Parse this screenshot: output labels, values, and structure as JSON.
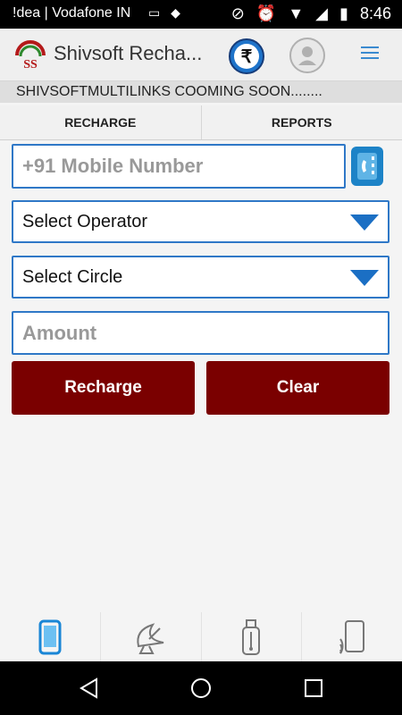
{
  "status_bar": {
    "carrier": "!dea | Vodafone IN",
    "time": "8:46"
  },
  "app_bar": {
    "title": "Shivsoft Recha...",
    "logo_text": "SS",
    "wallet_symbol": "₹"
  },
  "ticker": {
    "text": "SHIVSOFTMULTILINKS COOMING SOON........"
  },
  "tabs": [
    {
      "label": "RECHARGE"
    },
    {
      "label": "REPORTS"
    }
  ],
  "form": {
    "mobile_placeholder": "+91 Mobile Number",
    "operator_label": "Select Operator",
    "circle_label": "Select Circle",
    "amount_placeholder": "Amount",
    "recharge_label": "Recharge",
    "clear_label": "Clear"
  },
  "bottom_tools": [
    {
      "icon": "mobile-icon"
    },
    {
      "icon": "dth-dish-icon"
    },
    {
      "icon": "datacard-usb-icon"
    },
    {
      "icon": "prepaid-signal-icon"
    }
  ],
  "colors": {
    "accent": "#2f78c7",
    "button": "#7a0000",
    "caret": "#1b6fc4"
  }
}
